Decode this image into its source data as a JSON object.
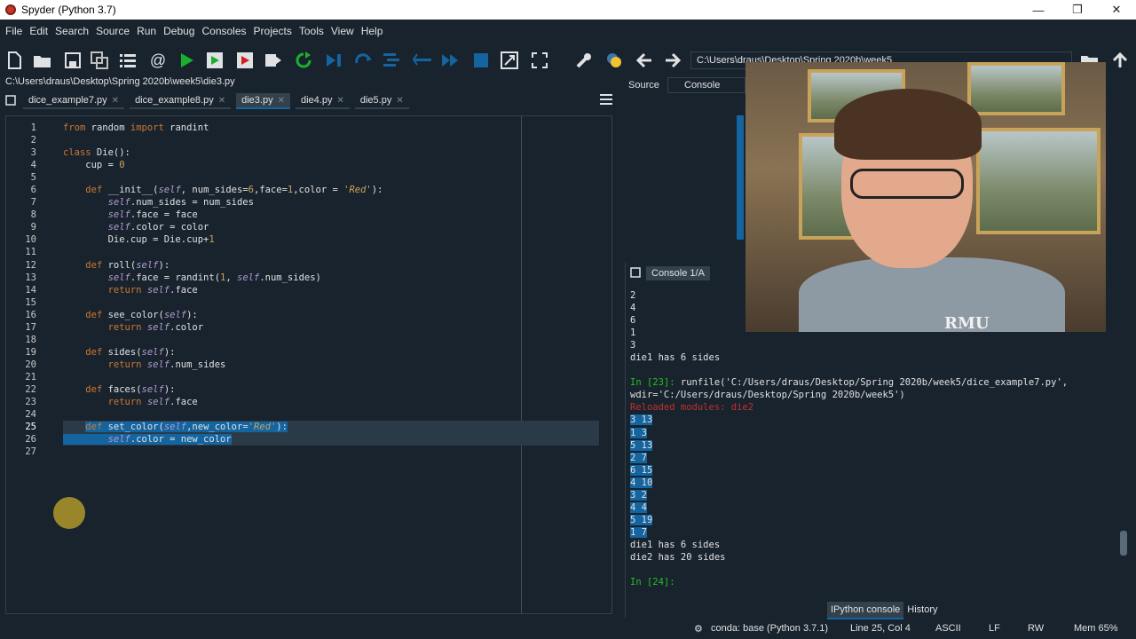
{
  "window": {
    "title": "Spyder (Python 3.7)"
  },
  "menu": [
    "File",
    "Edit",
    "Search",
    "Source",
    "Run",
    "Debug",
    "Consoles",
    "Projects",
    "Tools",
    "View",
    "Help"
  ],
  "working_dir": "C:\\Users\\draus\\Desktop\\Spring 2020b\\week5",
  "editor": {
    "file_path": "C:\\Users\\draus\\Desktop\\Spring 2020b\\week5\\die3.py",
    "tabs": [
      {
        "label": "dice_example7.py",
        "active": false
      },
      {
        "label": "dice_example8.py",
        "active": false
      },
      {
        "label": "die3.py",
        "active": true
      },
      {
        "label": "die4.py",
        "active": false
      },
      {
        "label": "die5.py",
        "active": false
      }
    ],
    "current_line": 25,
    "lines": [
      "from random import randint",
      "",
      "class Die():",
      "    cup = 0",
      "",
      "    def __init__(self, num_sides=6,face=1,color = 'Red'):",
      "        self.num_sides = num_sides",
      "        self.face = face",
      "        self.color = color",
      "        Die.cup = Die.cup+1",
      "",
      "    def roll(self):",
      "        self.face = randint(1, self.num_sides)",
      "        return self.face",
      "",
      "    def see_color(self):",
      "        return self.color",
      "",
      "    def sides(self):",
      "        return self.num_sides",
      "",
      "    def faces(self):",
      "        return self.face",
      "",
      "    def set_color(self,new_color='Red'):",
      "        self.color = new_color",
      ""
    ]
  },
  "help_pane": {
    "source_label": "Source",
    "source_value": "Console"
  },
  "console": {
    "tab_label": "Console 1/A",
    "pre_lines": [
      "2",
      "4",
      "6",
      "1",
      "3",
      "die1 has 6 sides",
      ""
    ],
    "prompt_in23": "In [23]: ",
    "runfile_cmd": "runfile('C:/Users/draus/Desktop/Spring 2020b/week5/dice_example7.py',",
    "runfile_wdir": "wdir='C:/Users/draus/Desktop/Spring 2020b/week5')",
    "reloaded": "Reloaded modules: die2",
    "selected_lines": [
      "3 13",
      "1 3",
      "5 13",
      "2 7",
      "6 15",
      "4 10",
      "3 2",
      "4 4",
      "5 19",
      "1 7"
    ],
    "post_lines": [
      "die1 has 6 sides",
      "die2 has 20 sides",
      ""
    ],
    "prompt_in24": "In [24]: "
  },
  "bottom_tabs": [
    "IPython console",
    "History"
  ],
  "status": {
    "conda": "conda: base (Python 3.7.1)",
    "position": "Line 25, Col 4",
    "encoding": "ASCII",
    "eol": "LF",
    "perm": "RW",
    "mem": "Mem 65%"
  },
  "webcam": {
    "shirt_text": "RMU"
  }
}
